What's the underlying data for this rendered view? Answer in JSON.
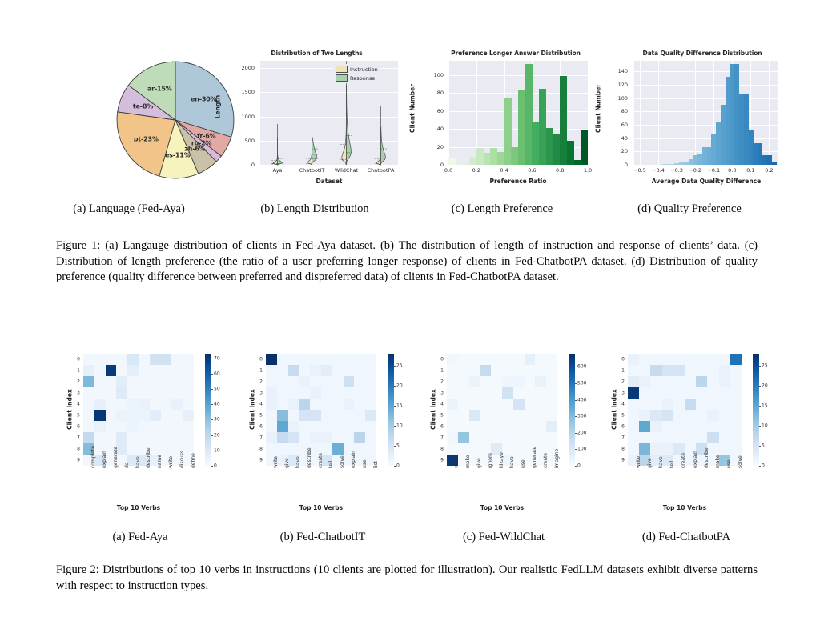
{
  "figure1": {
    "subcaptions": [
      "(a)  Language (Fed-Aya)",
      "(b)  Length Distribution",
      "(c)  Length Preference",
      "(d)  Quality Preference"
    ],
    "caption": "Figure 1: (a) Langauge distribution of clients in Fed-Aya dataset. (b) The distribution of length of instruction and response of clients’ data. (c) Distribution of length preference (the ratio of a user preferring longer response) of clients in Fed-ChatbotPA dataset. (d) Distribution of quality preference (quality difference between preferred and dispreferred data) of clients in Fed-ChatbotPA dataset."
  },
  "figure2": {
    "subcaptions": [
      "(a)  Fed-Aya",
      "(b)  Fed-ChatbotIT",
      "(c)  Fed-WildChat",
      "(d)  Fed-ChatbotPA"
    ],
    "caption": "Figure 2: Distributions of top 10 verbs in instructions (10 clients are plotted for illustration). Our realistic FedLLM datasets exhibit diverse patterns with respect to instruction types."
  },
  "chart_data": [
    {
      "type": "pie",
      "title": "",
      "labels": [
        "en-30%",
        "fr-6%",
        "ru-2%",
        "zh-6%",
        "es-11%",
        "pt-23%",
        "te-8%",
        "ar-15%"
      ],
      "names": [
        "en",
        "fr",
        "ru",
        "zh",
        "es",
        "pt",
        "te",
        "ar"
      ],
      "values": [
        30,
        6,
        2,
        6,
        11,
        23,
        8,
        15
      ],
      "colors": [
        "#aec7d9",
        "#e0a9a4",
        "#d9b8d9",
        "#c9c2a8",
        "#f7f3bd",
        "#f2c489",
        "#d5bedd",
        "#bedcb8"
      ],
      "startangle_deg": 90,
      "direction": "clockwise"
    },
    {
      "type": "area",
      "subtype": "violin",
      "title": "Distribution of Two Lengths",
      "xlabel": "Dataset",
      "ylabel": "Length",
      "categories": [
        "Aya",
        "ChatbotIT",
        "WildChat",
        "ChatbotPA"
      ],
      "ylim": [
        0,
        2150
      ],
      "yticks": [
        0,
        500,
        1000,
        1500,
        2000
      ],
      "legend": [
        "Instruction",
        "Response"
      ],
      "legend_position": "upper right",
      "legend_colors": [
        "#efe3b8",
        "#a8cfae"
      ],
      "grid": true,
      "series": [
        {
          "name": "Instruction",
          "stats": [
            {
              "category": "Aya",
              "median": 30,
              "q1": 15,
              "q3": 90,
              "max": 570,
              "bulge_at": 40
            },
            {
              "category": "ChatbotIT",
              "median": 60,
              "q1": 30,
              "q3": 130,
              "max": 640,
              "bulge_at": 60
            },
            {
              "category": "WildChat",
              "median": 225,
              "q1": 110,
              "q3": 420,
              "max": 2140,
              "bulge_at": 200
            },
            {
              "category": "ChatbotPA",
              "median": 55,
              "q1": 25,
              "q3": 120,
              "max": 1205,
              "bulge_at": 50
            }
          ]
        },
        {
          "name": "Response",
          "stats": [
            {
              "category": "Aya",
              "median": 60,
              "q1": 25,
              "q3": 130,
              "max": 840,
              "bulge_at": 55
            },
            {
              "category": "ChatbotIT",
              "median": 215,
              "q1": 120,
              "q3": 330,
              "max": 560,
              "bulge_at": 230
            },
            {
              "category": "WildChat",
              "median": 390,
              "q1": 250,
              "q3": 600,
              "max": 1640,
              "bulge_at": 380
            },
            {
              "category": "ChatbotPA",
              "median": 225,
              "q1": 140,
              "q3": 330,
              "max": 775,
              "bulge_at": 215
            }
          ]
        }
      ]
    },
    {
      "type": "bar",
      "subtype": "histogram",
      "title": "Preference Longer Answer Distribution",
      "xlabel": "Preference Ratio",
      "ylabel": "Client Number",
      "xlim": [
        0.0,
        1.0
      ],
      "xticks": [
        0.0,
        0.2,
        0.4,
        0.6,
        0.8,
        1.0
      ],
      "ylim": [
        0,
        116
      ],
      "yticks": [
        0,
        20,
        40,
        60,
        80,
        100
      ],
      "grid": true,
      "bin_edges": [
        0.0,
        0.05,
        0.1,
        0.15,
        0.2,
        0.25,
        0.3,
        0.35,
        0.4,
        0.45,
        0.5,
        0.55,
        0.6,
        0.65,
        0.7,
        0.75,
        0.8,
        0.85,
        0.9,
        0.95,
        1.0
      ],
      "bin_centers": [
        0.025,
        0.075,
        0.125,
        0.175,
        0.225,
        0.275,
        0.325,
        0.375,
        0.425,
        0.475,
        0.525,
        0.575,
        0.625,
        0.675,
        0.725,
        0.775,
        0.825,
        0.875,
        0.925,
        0.975
      ],
      "values": [
        8,
        1,
        1,
        9,
        19,
        13,
        19,
        14,
        74,
        20,
        84,
        112,
        48,
        85,
        41,
        35,
        99,
        27,
        5,
        38
      ],
      "colormap": "Greens",
      "color_start": "#f4faf3",
      "color_end": "#1d7a38"
    },
    {
      "type": "bar",
      "subtype": "histogram",
      "title": "Data Quality Difference Distribution",
      "xlabel": "Average Data Quality Difference",
      "ylabel": "Client Number",
      "xlim": [
        -0.53,
        0.25
      ],
      "xticks": [
        -0.5,
        -0.4,
        -0.3,
        -0.2,
        -0.1,
        0.0,
        0.1,
        0.2
      ],
      "ylim": [
        0,
        156
      ],
      "yticks": [
        0,
        20,
        40,
        60,
        80,
        100,
        120,
        140
      ],
      "grid": true,
      "bin_centers": [
        -0.5,
        -0.475,
        -0.45,
        -0.425,
        -0.4,
        -0.375,
        -0.35,
        -0.325,
        -0.3,
        -0.275,
        -0.25,
        -0.225,
        -0.2,
        -0.175,
        -0.15,
        -0.125,
        -0.1,
        -0.075,
        -0.05,
        -0.025,
        0.0,
        0.025,
        0.05,
        0.075,
        0.1,
        0.125,
        0.15,
        0.175,
        0.2,
        0.225
      ],
      "values": [
        0,
        0,
        0,
        0,
        0,
        1,
        1,
        1,
        2,
        4,
        5,
        8,
        15,
        17,
        26,
        26,
        46,
        65,
        90,
        132,
        151,
        151,
        107,
        107,
        52,
        33,
        33,
        15,
        15,
        4
      ],
      "colormap": "Blues",
      "color_start": "#cfe0f2",
      "color_end": "#2a64a8"
    },
    {
      "type": "heatmap",
      "panel": "(a) Fed-Aya",
      "xlabel": "Top 10 Verbs",
      "ylabel": "Client Index",
      "x_categories": [
        "complete",
        "explain",
        "generate",
        "do",
        "have",
        "describe",
        "name",
        "write",
        "discuss",
        "define"
      ],
      "y_categories": [
        "0",
        "1",
        "2",
        "3",
        "4",
        "5",
        "6",
        "7",
        "8",
        "9"
      ],
      "vmin": 0,
      "vmax": 73,
      "cbar_ticks": [
        0,
        10,
        20,
        30,
        40,
        50,
        60,
        70
      ],
      "colormap": "Blues",
      "values": [
        [
          2,
          2,
          2,
          2,
          11,
          2,
          14,
          14,
          2,
          2
        ],
        [
          6,
          2,
          70,
          2,
          7,
          2,
          2,
          2,
          2,
          2
        ],
        [
          33,
          2,
          2,
          8,
          2,
          2,
          2,
          2,
          2,
          2
        ],
        [
          2,
          2,
          2,
          9,
          2,
          2,
          2,
          2,
          2,
          2
        ],
        [
          2,
          6,
          2,
          2,
          4,
          5,
          2,
          2,
          5,
          2
        ],
        [
          2,
          71,
          2,
          4,
          4,
          4,
          8,
          2,
          2,
          6
        ],
        [
          2,
          5,
          2,
          2,
          4,
          3,
          2,
          2,
          2,
          2
        ],
        [
          19,
          2,
          2,
          9,
          2,
          2,
          2,
          2,
          2,
          2
        ],
        [
          32,
          2,
          2,
          9,
          2,
          2,
          2,
          2,
          2,
          2
        ],
        [
          2,
          11,
          2,
          2,
          10,
          11,
          6,
          2,
          2,
          2
        ]
      ]
    },
    {
      "type": "heatmap",
      "panel": "(b) Fed-ChatbotIT",
      "xlabel": "Top 10 Verbs",
      "ylabel": "Client Index",
      "x_categories": [
        "write",
        "give",
        "have",
        "describe",
        "create",
        "tell",
        "solve",
        "explain",
        "use",
        "list"
      ],
      "y_categories": [
        "0",
        "1",
        "2",
        "3",
        "4",
        "5",
        "6",
        "7",
        "8",
        "9"
      ],
      "vmin": 0,
      "vmax": 28,
      "cbar_ticks": [
        0,
        5,
        10,
        15,
        20,
        25
      ],
      "colormap": "Blues",
      "values": [
        [
          28,
          1,
          1,
          1,
          1,
          1,
          1,
          1,
          1,
          1
        ],
        [
          1,
          1,
          7,
          1,
          2,
          3,
          1,
          1,
          1,
          1
        ],
        [
          1,
          1,
          1,
          2,
          1,
          1,
          1,
          6,
          1,
          1
        ],
        [
          2,
          1,
          1,
          1,
          2,
          1,
          1,
          1,
          1,
          1
        ],
        [
          2,
          1,
          2,
          8,
          1,
          1,
          1,
          2,
          1,
          1
        ],
        [
          1,
          12,
          1,
          5,
          5,
          1,
          1,
          1,
          1,
          4
        ],
        [
          1,
          15,
          2,
          1,
          1,
          1,
          1,
          1,
          1,
          1
        ],
        [
          2,
          7,
          5,
          1,
          2,
          2,
          1,
          1,
          8,
          1
        ],
        [
          1,
          1,
          1,
          1,
          1,
          1,
          14,
          1,
          1,
          1
        ],
        [
          1,
          2,
          4,
          1,
          1,
          5,
          1,
          1,
          1,
          1
        ]
      ]
    },
    {
      "type": "heatmap",
      "panel": "(c) Fed-WildChat",
      "xlabel": "Top 10 Verbs",
      "ylabel": "Client Index",
      "x_categories": [
        "write",
        "make",
        "give",
        "ignore",
        "hikaye",
        "have",
        "use",
        "generate",
        "create",
        "imagine"
      ],
      "y_categories": [
        "0",
        "1",
        "2",
        "3",
        "4",
        "5",
        "6",
        "7",
        "8",
        "9"
      ],
      "vmin": 0,
      "vmax": 680,
      "cbar_ticks": [
        0,
        100,
        200,
        300,
        400,
        500,
        600
      ],
      "colormap": "Blues",
      "values": [
        [
          20,
          10,
          10,
          10,
          10,
          10,
          10,
          60,
          10,
          10
        ],
        [
          10,
          10,
          10,
          170,
          10,
          10,
          10,
          10,
          10,
          10
        ],
        [
          10,
          10,
          40,
          10,
          10,
          30,
          30,
          10,
          50,
          10
        ],
        [
          10,
          10,
          10,
          10,
          10,
          130,
          10,
          10,
          10,
          10
        ],
        [
          40,
          10,
          10,
          10,
          10,
          10,
          120,
          10,
          10,
          10
        ],
        [
          10,
          10,
          100,
          10,
          10,
          10,
          10,
          10,
          10,
          10
        ],
        [
          10,
          10,
          10,
          10,
          10,
          10,
          10,
          10,
          10,
          70
        ],
        [
          20,
          270,
          10,
          10,
          10,
          10,
          10,
          10,
          10,
          10
        ],
        [
          10,
          10,
          10,
          10,
          80,
          10,
          10,
          10,
          10,
          10
        ],
        [
          660,
          10,
          10,
          10,
          10,
          30,
          10,
          10,
          10,
          10
        ]
      ]
    },
    {
      "type": "heatmap",
      "panel": "(d) Fed-ChatbotPA",
      "xlabel": "Top 10 Verbs",
      "ylabel": "Client Index",
      "x_categories": [
        "write",
        "give",
        "have",
        "tell",
        "create",
        "explain",
        "describe",
        "make",
        "use",
        "solve"
      ],
      "y_categories": [
        "0",
        "1",
        "2",
        "3",
        "4",
        "5",
        "6",
        "7",
        "8",
        "9"
      ],
      "vmin": 0,
      "vmax": 28,
      "cbar_ticks": [
        0,
        5,
        10,
        15,
        20,
        25
      ],
      "colormap": "Blues",
      "values": [
        [
          2,
          1,
          1,
          1,
          1,
          1,
          1,
          1,
          1,
          21
        ],
        [
          1,
          1,
          7,
          5,
          5,
          1,
          1,
          1,
          2,
          1
        ],
        [
          3,
          2,
          1,
          1,
          1,
          1,
          8,
          1,
          2,
          1
        ],
        [
          27,
          1,
          1,
          1,
          1,
          1,
          1,
          1,
          1,
          1
        ],
        [
          1,
          1,
          1,
          2,
          1,
          7,
          1,
          1,
          1,
          1
        ],
        [
          1,
          2,
          4,
          5,
          1,
          1,
          1,
          2,
          1,
          1
        ],
        [
          1,
          15,
          2,
          1,
          1,
          1,
          1,
          1,
          1,
          1
        ],
        [
          1,
          1,
          1,
          1,
          1,
          1,
          1,
          6,
          1,
          1
        ],
        [
          1,
          13,
          2,
          2,
          4,
          1,
          6,
          1,
          1,
          1
        ],
        [
          2,
          8,
          3,
          4,
          1,
          1,
          1,
          1,
          11,
          1
        ]
      ]
    }
  ]
}
